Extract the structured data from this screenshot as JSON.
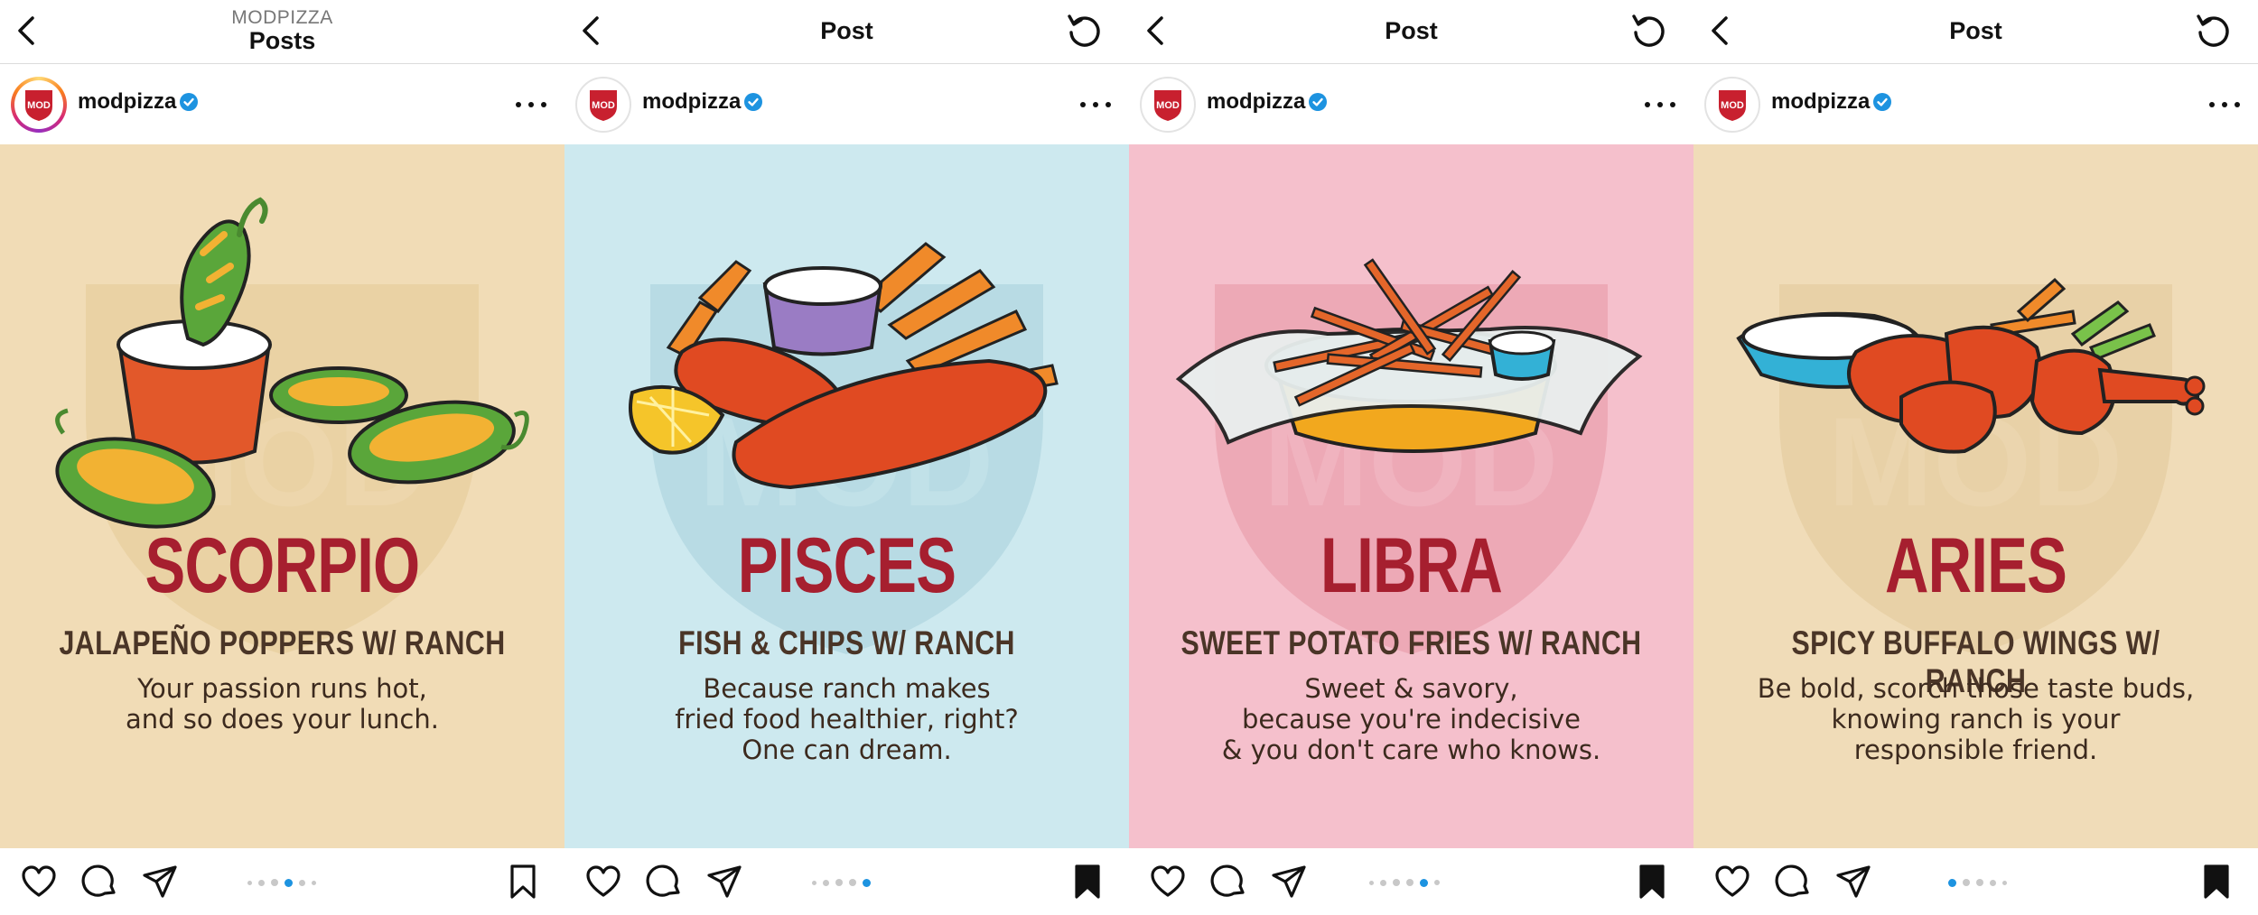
{
  "brand": {
    "accent_red": "#a61f2f",
    "dot_active": "#1d93e0",
    "dot_inactive": "#c8c8c8",
    "verified_blue": "#1d93e0"
  },
  "panels": [
    {
      "nav": {
        "back_icon": "chevron-left-icon",
        "subtitle": "MODPIZZA",
        "title": "Posts",
        "has_refresh": false
      },
      "post": {
        "username": "modpizza",
        "verified": true,
        "avatar_ring": true
      },
      "image": {
        "background": "#f1dcb6",
        "shield_color": "#e8cfa0",
        "food_icon": "jalapeno-poppers-illustration",
        "sign": "SCORPIO",
        "dish": "JALAPEÑO POPPERS W/ RANCH",
        "caption": [
          "Your passion runs hot,",
          "and so does your lunch."
        ]
      },
      "carousel": {
        "count": 6,
        "active": 3
      },
      "saved": false
    },
    {
      "nav": {
        "back_icon": "chevron-left-icon",
        "subtitle": "",
        "title": "Post",
        "has_refresh": true
      },
      "post": {
        "username": "modpizza",
        "verified": true,
        "avatar_ring": false
      },
      "image": {
        "background": "#cde9ef",
        "shield_color": "#b4d8e2",
        "food_icon": "fish-and-chips-illustration",
        "sign": "PISCES",
        "dish": "FISH & CHIPS W/ RANCH",
        "caption": [
          "Because ranch makes",
          "fried food healthier, right?",
          "One can dream."
        ]
      },
      "carousel": {
        "count": 5,
        "active": 4
      },
      "saved": true
    },
    {
      "nav": {
        "back_icon": "chevron-left-icon",
        "subtitle": "",
        "title": "Post",
        "has_refresh": true
      },
      "post": {
        "username": "modpizza",
        "verified": true,
        "avatar_ring": false
      },
      "image": {
        "background": "#f5c0cc",
        "shield_color": "#eba4b2",
        "food_icon": "sweet-potato-fries-illustration",
        "sign": "LIBRA",
        "dish": "SWEET POTATO FRIES W/ RANCH",
        "caption": [
          "Sweet & savory,",
          "because you're indecisive",
          "& you don't care who knows."
        ]
      },
      "carousel": {
        "count": 6,
        "active": 4
      },
      "saved": true
    },
    {
      "nav": {
        "back_icon": "chevron-left-icon",
        "subtitle": "",
        "title": "Post",
        "has_refresh": true
      },
      "post": {
        "username": "modpizza",
        "verified": true,
        "avatar_ring": false
      },
      "image": {
        "background": "#f0dcb8",
        "shield_color": "#e6cfa3",
        "food_icon": "buffalo-wings-illustration",
        "sign": "ARIES",
        "dish": "SPICY BUFFALO WINGS W/ RANCH",
        "caption": [
          "Be bold, scorch those taste buds,",
          "knowing ranch is your",
          "responsible friend."
        ]
      },
      "carousel": {
        "count": 5,
        "active": 1
      },
      "saved": true
    }
  ]
}
